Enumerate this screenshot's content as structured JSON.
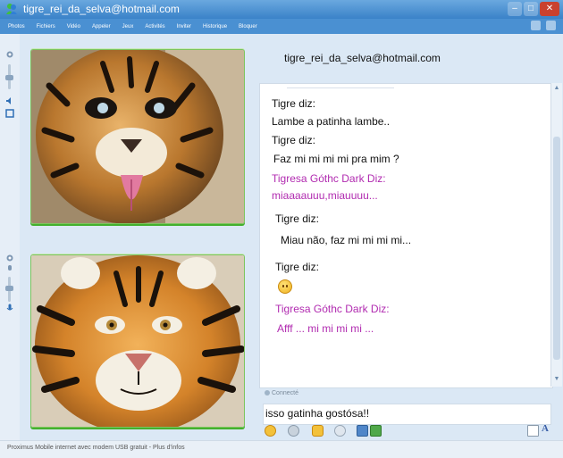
{
  "window": {
    "title": "tigre_rei_da_selva@hotmail.com"
  },
  "menu": {
    "items": [
      "Photos",
      "Fichiers",
      "Vidéo",
      "Appeler",
      "Jeux",
      "Activités",
      "Inviter",
      "Historique",
      "Bloquer"
    ]
  },
  "contact": {
    "email": "tigre_rei_da_selva@hotmail.com"
  },
  "conversation": {
    "messages": [
      {
        "sender": "Tigre diz:",
        "text": "Lambe a patinha lambe.."
      },
      {
        "sender": "Tigre diz:",
        "text": "Faz mi mi mi mi pra mim ?"
      },
      {
        "sender": "Tigresa Góthc Dark Diz:",
        "text": "miaaaauuu,miauuuu..."
      },
      {
        "sender": "Tigre diz:",
        "text": "Miau não, faz mi mi mi mi..."
      },
      {
        "sender": "Tigre diz:",
        "emoticon": "smile-emoticon"
      },
      {
        "sender": "Tigresa Góthc Dark Diz:",
        "text": "Afff ... mi mi mi mi ..."
      }
    ]
  },
  "status": {
    "connected": "Connecté"
  },
  "input": {
    "value": "isso gatinha gostósa!!"
  },
  "toolbar": {
    "font_label": "A"
  },
  "statusbar": {
    "text": "Proximus Mobile internet avec modem USB gratuit - Plus d'infos"
  },
  "colors": {
    "title_bg": "#3a82c8",
    "menu_bg": "#4a90d2",
    "tigresa_text": "#b12bb0",
    "photo_frame": "#44b02e"
  }
}
